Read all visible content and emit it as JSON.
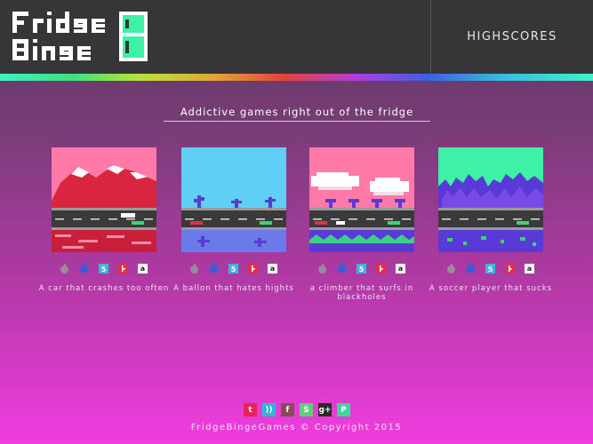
{
  "brand": {
    "logo_text": "FridgeBinge"
  },
  "nav": {
    "highscores": "HIGHSCORES"
  },
  "tagline": "Addictive games right out of the fridge",
  "platform_icons": [
    "apple-icon",
    "android-icon",
    "html5-icon",
    "flash-icon",
    "amazon-icon"
  ],
  "games": [
    {
      "description": "A car that crashes too often",
      "theme": "mountains"
    },
    {
      "description": "A ballon that hates hights",
      "theme": "desert"
    },
    {
      "description": "a climber that surfs in blackholes",
      "theme": "clouds"
    },
    {
      "description": "A soccer player that sucks",
      "theme": "forest"
    }
  ],
  "social_icons": [
    "twitter-icon",
    "rss-icon",
    "facebook-icon",
    "skype-icon",
    "google-plus-icon",
    "pinterest-icon"
  ],
  "footer": {
    "copyright": "FridgeBingeGames © Copyright 2015"
  },
  "colors": {
    "header_bg": "#363638",
    "twitter": "#e8245a",
    "rss": "#2bb9d9",
    "facebook": "#8a4a5a",
    "skype": "#5fd07a",
    "google_plus": "#2a2a2a",
    "pinterest": "#3ad6a0"
  }
}
